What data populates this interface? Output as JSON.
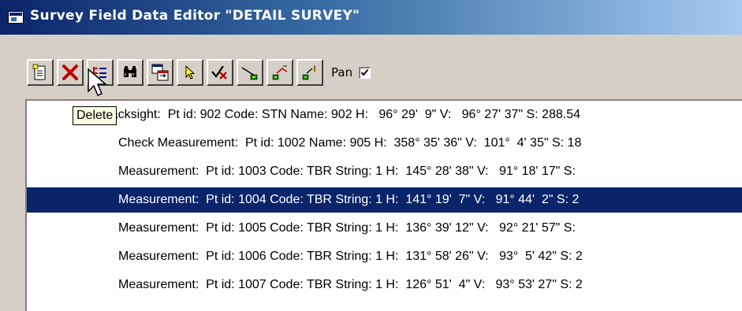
{
  "window": {
    "title": "Survey Field Data Editor \"DETAIL SURVEY\""
  },
  "toolbar": {
    "buttons": [
      {
        "name": "new-record-icon"
      },
      {
        "name": "delete-icon"
      },
      {
        "name": "list-tree-icon"
      },
      {
        "name": "find-binoculars-icon"
      },
      {
        "name": "copy-window-icon"
      },
      {
        "name": "pointer-select-icon"
      },
      {
        "name": "check-measurement-icon"
      },
      {
        "name": "backsight-icon"
      },
      {
        "name": "string-line-icon"
      },
      {
        "name": "string-edit-icon"
      }
    ],
    "pan_label": "Pan",
    "pan_checked": true
  },
  "tooltip": {
    "text": "Delete"
  },
  "records": [
    {
      "text": "Backsight:  Pt id: 902 Code: STN Name: 902 H:   96° 29'  9\" V:   96° 27' 37\" S: 288.54"
    },
    {
      "text": "Check Measurement:  Pt id: 1002 Name: 905 H:  358° 35' 36\" V:  101°  4' 35\" S: 18"
    },
    {
      "text": "Measurement:  Pt id: 1003 Code: TBR String: 1 H:  145° 28' 38\" V:   91° 18' 17\" S:"
    },
    {
      "text": "Measurement:  Pt id: 1004 Code: TBR String: 1 H:  141° 19'  7\" V:   91° 44'  2\" S: 2"
    },
    {
      "text": "Measurement:  Pt id: 1005 Code: TBR String: 1 H:  136° 39' 12\" V:   92° 21' 57\" S:"
    },
    {
      "text": "Measurement:  Pt id: 1006 Code: TBR String: 1 H:  131° 58' 26\" V:   93°  5' 42\" S: 2"
    },
    {
      "text": "Measurement:  Pt id: 1007 Code: TBR String: 1 H:  126° 51'  4\" V:   93° 53' 27\" S: 2"
    }
  ],
  "selected_index": 3
}
